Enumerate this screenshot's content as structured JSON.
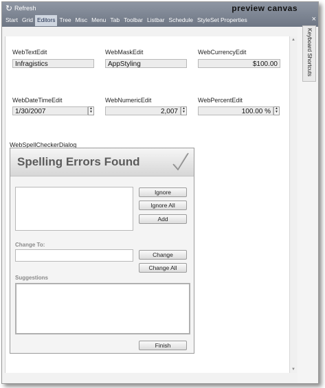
{
  "topbar": {
    "refresh_label": "Refresh",
    "canvas_title": "preview canvas",
    "menu": [
      "Start",
      "Grid",
      "Editors",
      "Tree",
      "Misc",
      "Menu",
      "Tab",
      "Toolbar",
      "Listbar",
      "Schedule",
      "StyleSet Properties"
    ],
    "active_menu": "Editors",
    "close_glyph": "×"
  },
  "side_tab": {
    "label": "Keyboard Shortcuts"
  },
  "editors": {
    "text_edit": {
      "label": "WebTextEdit",
      "value": "Infragistics"
    },
    "mask_edit": {
      "label": "WebMaskEdit",
      "value": "AppStyling"
    },
    "currency_edit": {
      "label": "WebCurrencyEdit",
      "value": "$100.00"
    },
    "datetime_edit": {
      "label": "WebDateTimeEdit",
      "value": "1/30/2007"
    },
    "numeric_edit": {
      "label": "WebNumericEdit",
      "value": "2,007"
    },
    "percent_edit": {
      "label": "WebPercentEdit",
      "value": "100.00 %"
    }
  },
  "spellchecker": {
    "section_label": "WebSpellCheckerDialog",
    "title": "Spelling Errors Found",
    "buttons": {
      "ignore": "Ignore",
      "ignore_all": "Ignore All",
      "add": "Add",
      "change": "Change",
      "change_all": "Change All",
      "finish": "Finish"
    },
    "change_to_label": "Change To:",
    "suggestions_label": "Suggestions"
  },
  "colors": {
    "topbar": "#7e8694",
    "active_tab": "#cfd6e0",
    "dialog_title": "#5b5b5b"
  }
}
